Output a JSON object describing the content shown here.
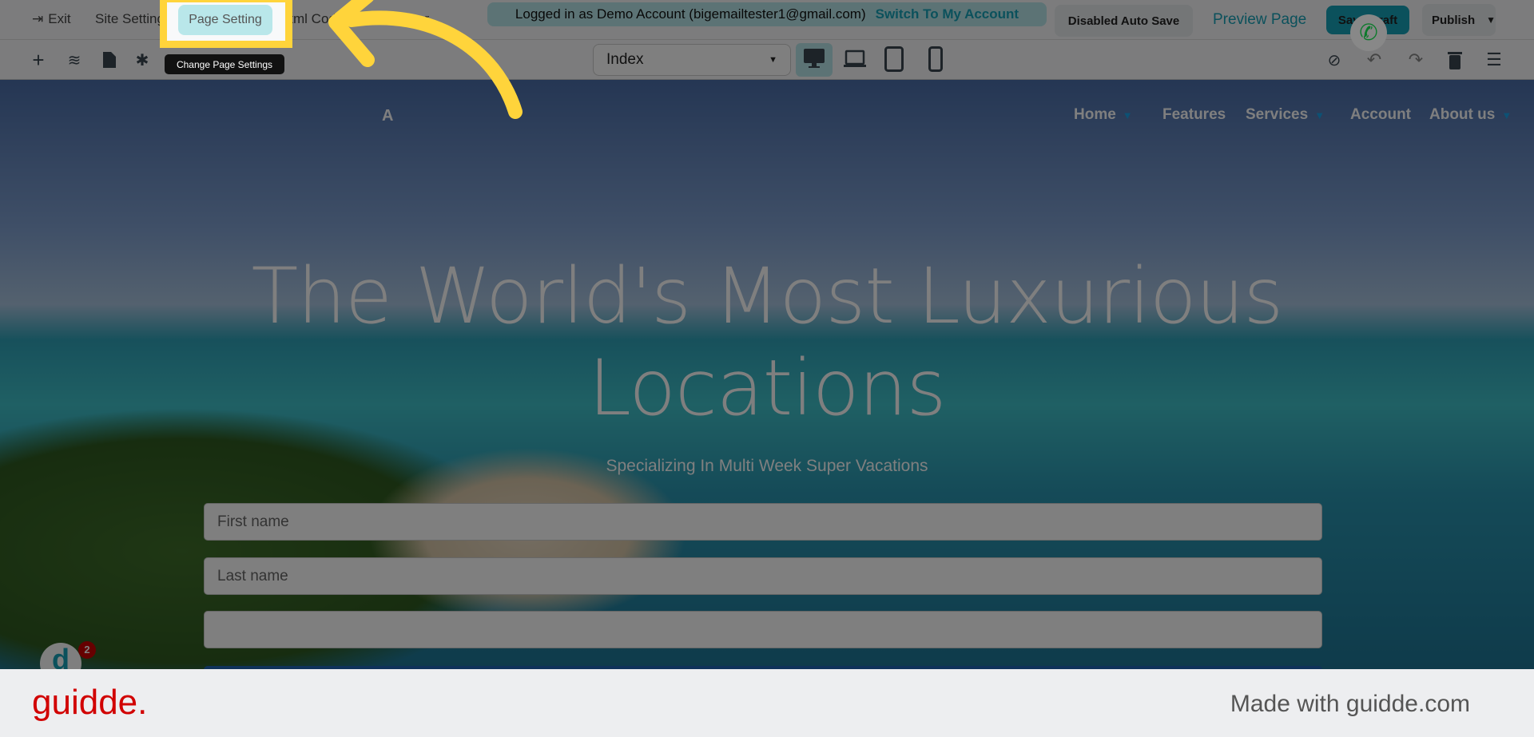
{
  "topbar": {
    "exit": "Exit",
    "site_setting": "Site Setting",
    "page_setting": "Page Setting",
    "html_code": "Html Code",
    "manager": "Manager",
    "logged_in": "Logged in as Demo Account (bigemailtester1@gmail.com)",
    "switch_account": "Switch To My Account",
    "auto_save": "Disabled Auto Save",
    "preview": "Preview Page",
    "save_draft": "Save Draft",
    "publish": "Publish"
  },
  "tooltip": "Change Page Settings",
  "toolbar": {
    "page_select": "Index"
  },
  "site": {
    "nav": [
      "Home",
      "Features",
      "Services",
      "Account",
      "About us"
    ],
    "hero_line1": "The World's Most Luxurious",
    "hero_line2": "Locations",
    "subtitle": "Specializing In Multi Week Super Vacations",
    "placeholders": {
      "first": "First name",
      "last": "Last name"
    }
  },
  "chat_badge": "2",
  "footer": {
    "logo": "guidde.",
    "made_with": "Made with guidde.com"
  },
  "colors": {
    "accent": "#17a2b8",
    "highlight": "#ffd43b",
    "guidde": "#d10000"
  }
}
